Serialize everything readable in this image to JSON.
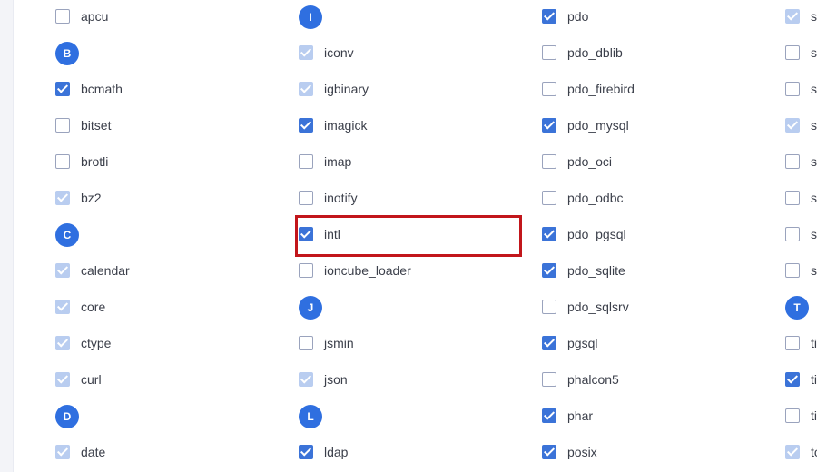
{
  "extensions": {
    "columns": [
      {
        "entries": [
          {
            "kind": "item",
            "label": "apcu",
            "state": "unchecked"
          },
          {
            "kind": "header",
            "letter": "B"
          },
          {
            "kind": "item",
            "label": "bcmath",
            "state": "checked"
          },
          {
            "kind": "item",
            "label": "bitset",
            "state": "unchecked"
          },
          {
            "kind": "item",
            "label": "brotli",
            "state": "unchecked"
          },
          {
            "kind": "item",
            "label": "bz2",
            "state": "disabled"
          },
          {
            "kind": "header",
            "letter": "C"
          },
          {
            "kind": "item",
            "label": "calendar",
            "state": "disabled"
          },
          {
            "kind": "item",
            "label": "core",
            "state": "disabled"
          },
          {
            "kind": "item",
            "label": "ctype",
            "state": "disabled"
          },
          {
            "kind": "item",
            "label": "curl",
            "state": "disabled"
          },
          {
            "kind": "header",
            "letter": "D"
          },
          {
            "kind": "item",
            "label": "date",
            "state": "disabled"
          }
        ]
      },
      {
        "entries": [
          {
            "kind": "header",
            "letter": "I"
          },
          {
            "kind": "item",
            "label": "iconv",
            "state": "disabled"
          },
          {
            "kind": "item",
            "label": "igbinary",
            "state": "disabled"
          },
          {
            "kind": "item",
            "label": "imagick",
            "state": "checked"
          },
          {
            "kind": "item",
            "label": "imap",
            "state": "unchecked"
          },
          {
            "kind": "item",
            "label": "inotify",
            "state": "unchecked"
          },
          {
            "kind": "item",
            "label": "intl",
            "state": "checked"
          },
          {
            "kind": "item",
            "label": "ioncube_loader",
            "state": "unchecked"
          },
          {
            "kind": "header",
            "letter": "J"
          },
          {
            "kind": "item",
            "label": "jsmin",
            "state": "unchecked"
          },
          {
            "kind": "item",
            "label": "json",
            "state": "disabled"
          },
          {
            "kind": "header",
            "letter": "L"
          },
          {
            "kind": "item",
            "label": "ldap",
            "state": "checked"
          }
        ]
      },
      {
        "entries": [
          {
            "kind": "item",
            "label": "pdo",
            "state": "checked"
          },
          {
            "kind": "item",
            "label": "pdo_dblib",
            "state": "unchecked"
          },
          {
            "kind": "item",
            "label": "pdo_firebird",
            "state": "unchecked"
          },
          {
            "kind": "item",
            "label": "pdo_mysql",
            "state": "checked"
          },
          {
            "kind": "item",
            "label": "pdo_oci",
            "state": "unchecked"
          },
          {
            "kind": "item",
            "label": "pdo_odbc",
            "state": "unchecked"
          },
          {
            "kind": "item",
            "label": "pdo_pgsql",
            "state": "checked"
          },
          {
            "kind": "item",
            "label": "pdo_sqlite",
            "state": "checked"
          },
          {
            "kind": "item",
            "label": "pdo_sqlsrv",
            "state": "unchecked"
          },
          {
            "kind": "item",
            "label": "pgsql",
            "state": "checked"
          },
          {
            "kind": "item",
            "label": "phalcon5",
            "state": "unchecked"
          },
          {
            "kind": "item",
            "label": "phar",
            "state": "checked"
          },
          {
            "kind": "item",
            "label": "posix",
            "state": "checked"
          }
        ]
      },
      {
        "entries": [
          {
            "kind": "item",
            "label": "s",
            "state": "disabled"
          },
          {
            "kind": "item",
            "label": "s",
            "state": "unchecked"
          },
          {
            "kind": "item",
            "label": "s",
            "state": "unchecked"
          },
          {
            "kind": "item",
            "label": "s",
            "state": "disabled"
          },
          {
            "kind": "item",
            "label": "s",
            "state": "unchecked"
          },
          {
            "kind": "item",
            "label": "s",
            "state": "unchecked"
          },
          {
            "kind": "item",
            "label": "s",
            "state": "unchecked"
          },
          {
            "kind": "item",
            "label": "s",
            "state": "unchecked"
          },
          {
            "kind": "header",
            "letter": "T"
          },
          {
            "kind": "item",
            "label": "ti",
            "state": "unchecked"
          },
          {
            "kind": "item",
            "label": "ti",
            "state": "checked"
          },
          {
            "kind": "item",
            "label": "ti",
            "state": "unchecked"
          },
          {
            "kind": "item",
            "label": "to",
            "state": "disabled"
          }
        ]
      }
    ]
  },
  "highlight": {
    "target": "intl"
  },
  "colors": {
    "accent": "#2f6fe0",
    "checked": "#3b73d8",
    "disabled": "#b9cdf0",
    "highlight": "#c2161b"
  }
}
